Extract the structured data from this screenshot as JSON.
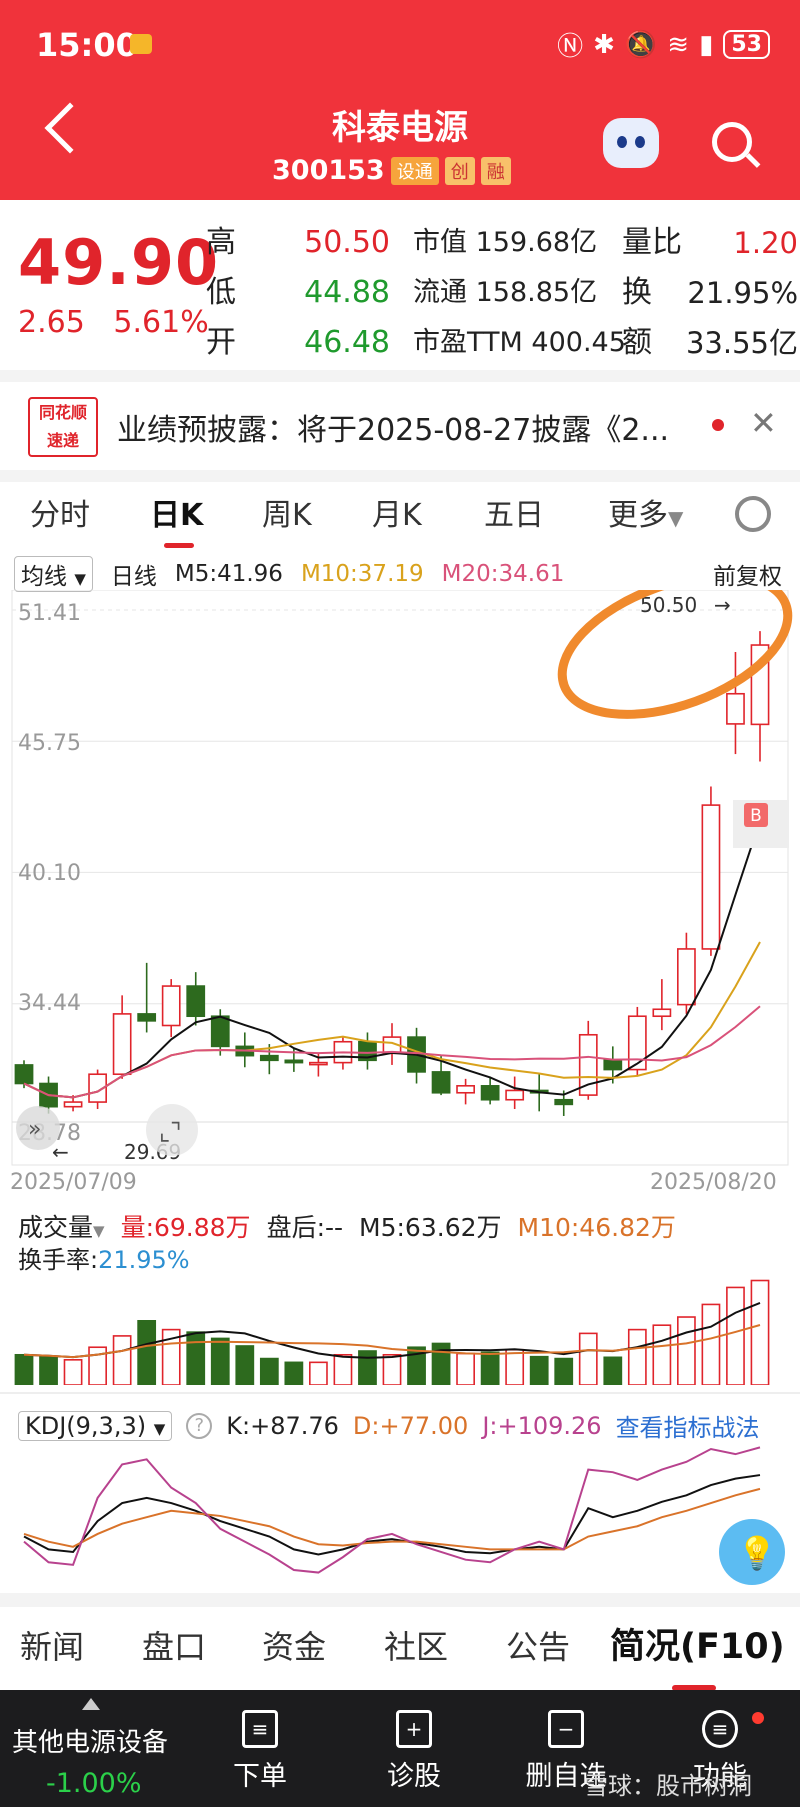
{
  "status": {
    "time": "15:00",
    "battery": "53"
  },
  "header": {
    "title": "科泰电源",
    "code": "300153",
    "tags": [
      "设通",
      "创",
      "融"
    ]
  },
  "quote": {
    "price": "49.90",
    "change": "2.65",
    "change_pct": "5.61%",
    "high_label": "高",
    "high": "50.50",
    "low_label": "低",
    "low": "44.88",
    "open_label": "开",
    "open": "46.48",
    "mcap_label": "市值",
    "mcap": "159.68亿",
    "float_label": "流通",
    "float": "158.85亿",
    "pe_label": "市盈TTM",
    "pe": "400.45",
    "volratio_label": "量比",
    "volratio": "1.20",
    "turnover_label": "换",
    "turnover": "21.95%",
    "amount_label": "额",
    "amount": "33.55亿"
  },
  "news": {
    "source_logo": "同花顺 速递",
    "text": "业绩预披露：将于2025-08-27披露《2..."
  },
  "period_tabs": [
    "分时",
    "日K",
    "周K",
    "月K",
    "五日",
    "更多"
  ],
  "ma_bar": {
    "selector": "均线",
    "period": "日线",
    "m5": "M5:41.96",
    "m10": "M10:37.19",
    "m20": "M20:34.61",
    "adjust": "前复权"
  },
  "chart_labels": {
    "y1": "51.41",
    "y2": "45.75",
    "y3": "40.10",
    "y4": "34.44",
    "y5": "28.78",
    "hi_mark": "50.50",
    "lo_mark": "29.69",
    "date_start": "2025/07/09",
    "date_end": "2025/08/20",
    "buy": "B"
  },
  "volume_bar": {
    "selector": "成交量",
    "vol": "量:69.88万",
    "after": "盘后:--",
    "m5": "M5:63.62万",
    "m10": "M10:46.82万",
    "turnover_label": "换手率:",
    "turnover": "21.95%"
  },
  "kdj_bar": {
    "selector": "KDJ(9,3,3)",
    "k": "K:+87.76",
    "d": "D:+77.00",
    "j": "J:+109.26",
    "link": "查看指标战法"
  },
  "bottom_tabs": [
    "新闻",
    "盘口",
    "资金",
    "社区",
    "公告",
    "简况(F10)"
  ],
  "action_bar": {
    "sector": "其他电源设备",
    "sector_pct": "-1.00%",
    "items": [
      "下单",
      "诊股",
      "删自选",
      "功能"
    ]
  },
  "watermark": "雪球：股市树洞",
  "colors": {
    "up": "#e0242b",
    "down": "#2d6a1e",
    "header": "#f0333b",
    "m5": "#111111",
    "m10": "#d9a21c",
    "m20": "#d9527a"
  },
  "chart_data": {
    "type": "candlestick",
    "x": [
      "2025/07/09",
      "",
      "",
      "",
      "",
      "",
      "",
      "",
      "",
      "",
      "",
      "",
      "",
      "",
      "",
      "",
      "",
      "",
      "",
      "",
      "",
      "",
      "",
      "",
      "",
      "",
      "",
      "",
      "",
      "",
      "2025/08/20"
    ],
    "candles": [
      [
        31.8,
        32.0,
        30.8,
        31.0
      ],
      [
        31.0,
        31.3,
        29.7,
        30.0
      ],
      [
        30.0,
        30.5,
        29.8,
        30.2
      ],
      [
        30.2,
        31.6,
        29.9,
        31.4
      ],
      [
        31.4,
        34.8,
        31.2,
        34.0
      ],
      [
        34.0,
        36.2,
        33.2,
        33.7
      ],
      [
        33.5,
        35.5,
        33.0,
        35.2
      ],
      [
        35.2,
        35.8,
        33.5,
        33.9
      ],
      [
        33.9,
        34.2,
        32.2,
        32.6
      ],
      [
        32.6,
        33.2,
        31.7,
        32.2
      ],
      [
        32.2,
        32.7,
        31.4,
        32.0
      ],
      [
        32.0,
        32.5,
        31.5,
        31.9
      ],
      [
        31.9,
        32.3,
        31.3,
        31.9
      ],
      [
        31.9,
        33.0,
        31.6,
        32.8
      ],
      [
        32.8,
        33.2,
        31.6,
        32.0
      ],
      [
        32.3,
        33.6,
        31.8,
        33.0
      ],
      [
        33.0,
        33.4,
        31.0,
        31.5
      ],
      [
        31.5,
        32.2,
        30.5,
        30.6
      ],
      [
        30.6,
        31.2,
        30.1,
        30.9
      ],
      [
        30.9,
        31.3,
        30.1,
        30.3
      ],
      [
        30.3,
        31.3,
        29.9,
        30.7
      ],
      [
        30.7,
        31.4,
        29.8,
        30.6
      ],
      [
        30.3,
        30.7,
        29.6,
        30.1
      ],
      [
        30.5,
        33.7,
        30.3,
        33.1
      ],
      [
        32.0,
        32.6,
        31.0,
        31.6
      ],
      [
        31.6,
        34.3,
        31.3,
        33.9
      ],
      [
        33.9,
        35.5,
        33.3,
        34.2
      ],
      [
        34.4,
        37.5,
        34.0,
        36.8
      ],
      [
        36.8,
        43.8,
        36.5,
        43.0
      ],
      [
        46.5,
        49.6,
        45.2,
        47.8
      ],
      [
        46.48,
        50.5,
        44.88,
        49.9
      ]
    ],
    "ylim": [
      28.78,
      51.41
    ],
    "volume": [
      48,
      45,
      40,
      60,
      78,
      102,
      88,
      84,
      74,
      62,
      42,
      36,
      36,
      48,
      54,
      48,
      60,
      66,
      50,
      52,
      56,
      45,
      42,
      82,
      44,
      88,
      95,
      108,
      128,
      155,
      166
    ],
    "kdj": {
      "K": [
        40,
        30,
        28,
        52,
        66,
        70,
        66,
        60,
        52,
        46,
        40,
        30,
        26,
        30,
        36,
        38,
        35,
        32,
        28,
        27,
        30,
        32,
        30,
        62,
        55,
        60,
        67,
        72,
        80,
        85,
        87.76
      ],
      "D": [
        42,
        36,
        32,
        42,
        50,
        55,
        60,
        58,
        56,
        52,
        48,
        40,
        34,
        33,
        35,
        36,
        36,
        34,
        32,
        30,
        30,
        30,
        30,
        40,
        44,
        48,
        55,
        60,
        66,
        72,
        77.0
      ],
      "J": [
        36,
        20,
        18,
        70,
        96,
        100,
        78,
        66,
        46,
        36,
        26,
        14,
        12,
        24,
        38,
        42,
        34,
        28,
        22,
        20,
        30,
        36,
        30,
        92,
        90,
        84,
        92,
        98,
        108,
        104,
        109.26
      ]
    }
  }
}
